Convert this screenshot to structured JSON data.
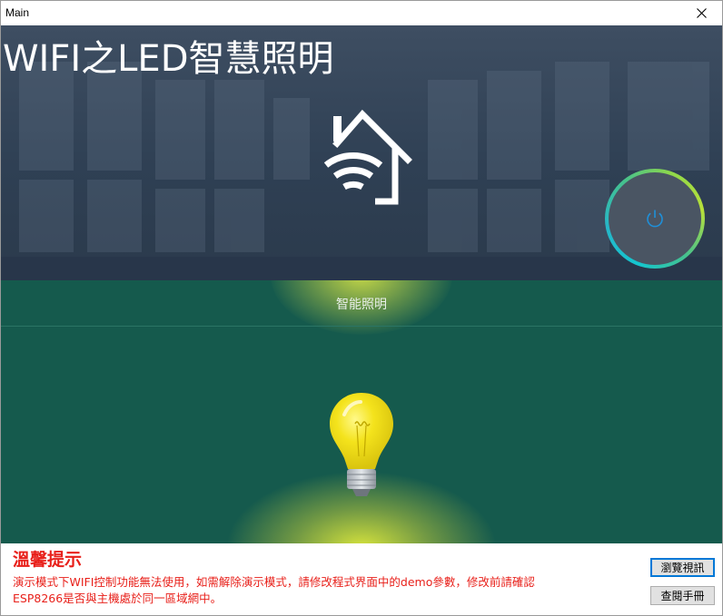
{
  "window": {
    "title": "Main"
  },
  "hero": {
    "app_title": "WIFI之LED智慧照明"
  },
  "lighting": {
    "label": "智能照明"
  },
  "footer": {
    "heading": "溫馨提示",
    "line1": "演示模式下WIFI控制功能無法使用，如需解除演示模式，請修改程式界面中的demo參數，修改前請確認",
    "line2": "ESP8266是否與主機處於同一區域網中。",
    "browse_button": "瀏覽視訊",
    "manual_button": "查閱手冊"
  },
  "colors": {
    "hero_bg": "#2f4054",
    "lighting_bg": "#155a4d",
    "warning_text": "#e8201a",
    "power_ring_start": "#14c6cf",
    "power_ring_end": "#b7e03a",
    "power_symbol": "#1f8fd8",
    "bulb": "#f2e21a"
  },
  "icons": {
    "close": "close-icon",
    "home": "home-wifi-icon",
    "power": "power-icon",
    "bulb": "light-bulb-icon"
  }
}
